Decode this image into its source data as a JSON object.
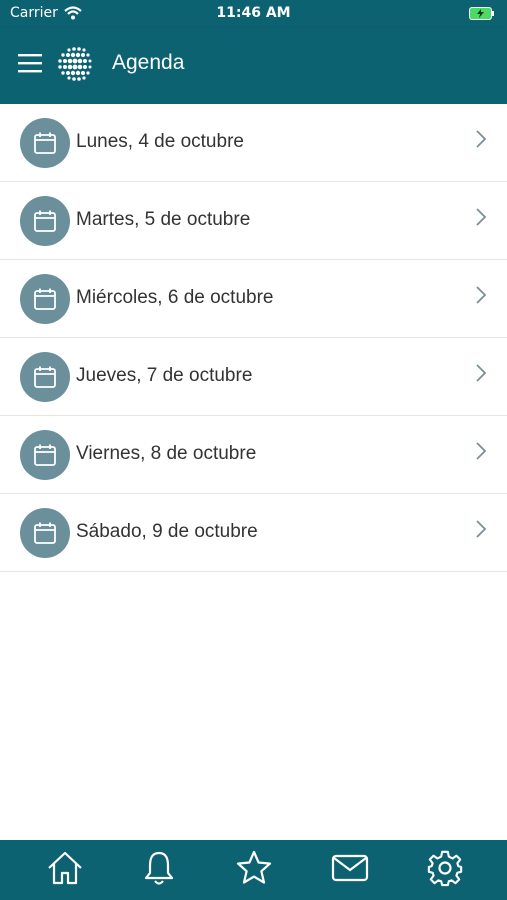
{
  "status": {
    "carrier": "Carrier",
    "time": "11:46 AM"
  },
  "header": {
    "title": "Agenda"
  },
  "agenda": {
    "items": [
      {
        "label": "Lunes, 4 de octubre"
      },
      {
        "label": "Martes, 5 de octubre"
      },
      {
        "label": "Miércoles, 6 de octubre"
      },
      {
        "label": "Jueves, 7 de octubre"
      },
      {
        "label": "Viernes, 8 de octubre"
      },
      {
        "label": "Sábado, 9 de octubre"
      }
    ]
  },
  "tabbar": {
    "items": [
      {
        "icon": "home-icon"
      },
      {
        "icon": "bell-icon"
      },
      {
        "icon": "star-icon"
      },
      {
        "icon": "mail-icon"
      },
      {
        "icon": "gear-icon"
      }
    ]
  },
  "colors": {
    "brand": "#0d6272",
    "calendar_circle": "#6b909c",
    "battery": "#4cd964"
  }
}
